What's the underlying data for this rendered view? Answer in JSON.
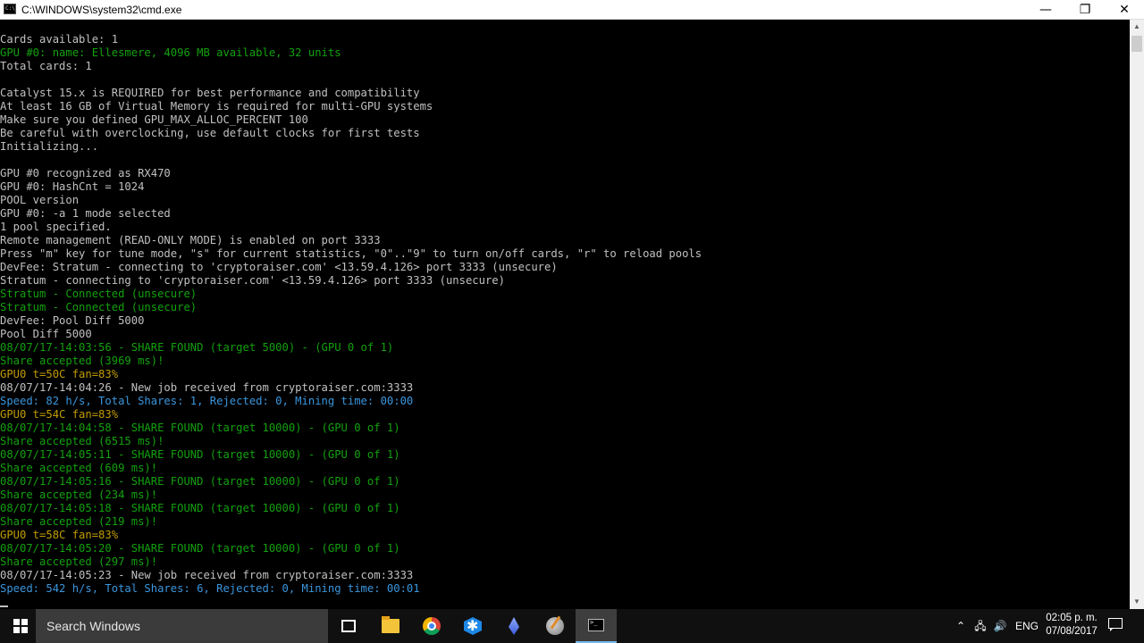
{
  "window": {
    "title": "C:\\WINDOWS\\system32\\cmd.exe",
    "minimize_glyph": "—",
    "maximize_glyph": "❐",
    "close_glyph": "✕"
  },
  "console": {
    "colors": {
      "white": "#c0c0c0",
      "green": "#13a10e",
      "yellow": "#c19c00",
      "cyan": "#3a96dd"
    },
    "lines": [
      {
        "text": "Cards available: 1",
        "color": "white"
      },
      {
        "text": "GPU #0: name: Ellesmere, 4096 MB available, 32 units",
        "color": "green"
      },
      {
        "text": "Total cards: 1",
        "color": "white"
      },
      {
        "text": "",
        "color": "white"
      },
      {
        "text": "Catalyst 15.x is REQUIRED for best performance and compatibility",
        "color": "white"
      },
      {
        "text": "At least 16 GB of Virtual Memory is required for multi-GPU systems",
        "color": "white"
      },
      {
        "text": "Make sure you defined GPU_MAX_ALLOC_PERCENT 100",
        "color": "white"
      },
      {
        "text": "Be careful with overclocking, use default clocks for first tests",
        "color": "white"
      },
      {
        "text": "Initializing...",
        "color": "white"
      },
      {
        "text": "",
        "color": "white"
      },
      {
        "text": "GPU #0 recognized as RX470",
        "color": "white"
      },
      {
        "text": "GPU #0: HashCnt = 1024",
        "color": "white"
      },
      {
        "text": "POOL version",
        "color": "white"
      },
      {
        "text": "GPU #0: -a 1 mode selected",
        "color": "white"
      },
      {
        "text": "1 pool specified.",
        "color": "white"
      },
      {
        "text": "Remote management (READ-ONLY MODE) is enabled on port 3333",
        "color": "white"
      },
      {
        "text": "Press \"m\" key for tune mode, \"s\" for current statistics, \"0\"..\"9\" to turn on/off cards, \"r\" to reload pools",
        "color": "white"
      },
      {
        "text": "DevFee: Stratum - connecting to 'cryptoraiser.com' <13.59.4.126> port 3333 (unsecure)",
        "color": "white"
      },
      {
        "text": "Stratum - connecting to 'cryptoraiser.com' <13.59.4.126> port 3333 (unsecure)",
        "color": "white"
      },
      {
        "text": "Stratum - Connected (unsecure)",
        "color": "green"
      },
      {
        "text": "Stratum - Connected (unsecure)",
        "color": "green"
      },
      {
        "text": "DevFee: Pool Diff 5000",
        "color": "white"
      },
      {
        "text": "Pool Diff 5000",
        "color": "white"
      },
      {
        "text": "08/07/17-14:03:56 - SHARE FOUND (target 5000) - (GPU 0 of 1)",
        "color": "green"
      },
      {
        "text": "Share accepted (3969 ms)!",
        "color": "green"
      },
      {
        "text": "GPU0 t=50C fan=83%",
        "color": "yellow"
      },
      {
        "text": "08/07/17-14:04:26 - New job received from cryptoraiser.com:3333",
        "color": "white"
      },
      {
        "text": "Speed: 82 h/s, Total Shares: 1, Rejected: 0, Mining time: 00:00",
        "color": "cyan"
      },
      {
        "text": "GPU0 t=54C fan=83%",
        "color": "yellow"
      },
      {
        "text": "08/07/17-14:04:58 - SHARE FOUND (target 10000) - (GPU 0 of 1)",
        "color": "green"
      },
      {
        "text": "Share accepted (6515 ms)!",
        "color": "green"
      },
      {
        "text": "08/07/17-14:05:11 - SHARE FOUND (target 10000) - (GPU 0 of 1)",
        "color": "green"
      },
      {
        "text": "Share accepted (609 ms)!",
        "color": "green"
      },
      {
        "text": "08/07/17-14:05:16 - SHARE FOUND (target 10000) - (GPU 0 of 1)",
        "color": "green"
      },
      {
        "text": "Share accepted (234 ms)!",
        "color": "green"
      },
      {
        "text": "08/07/17-14:05:18 - SHARE FOUND (target 10000) - (GPU 0 of 1)",
        "color": "green"
      },
      {
        "text": "Share accepted (219 ms)!",
        "color": "green"
      },
      {
        "text": "GPU0 t=58C fan=83%",
        "color": "yellow"
      },
      {
        "text": "08/07/17-14:05:20 - SHARE FOUND (target 10000) - (GPU 0 of 1)",
        "color": "green"
      },
      {
        "text": "Share accepted (297 ms)!",
        "color": "green"
      },
      {
        "text": "08/07/17-14:05:23 - New job received from cryptoraiser.com:3333",
        "color": "white"
      },
      {
        "text": "Speed: 542 h/s, Total Shares: 6, Rejected: 0, Mining time: 00:01",
        "color": "cyan"
      }
    ]
  },
  "scrollbar": {
    "up_glyph": "▲",
    "down_glyph": "▼"
  },
  "taskbar": {
    "search_placeholder": "Search Windows",
    "apps": [
      "task-view-icon",
      "file-explorer-icon",
      "chrome-icon",
      "snowflake-app-icon",
      "ethereum-icon",
      "utility-app-icon",
      "command-prompt-icon"
    ],
    "tray": {
      "chevron_glyph": "⌃",
      "network_glyph": "🖧",
      "volume_glyph": "🔊",
      "language": "ENG",
      "time": "02:05 p. m.",
      "date": "07/08/2017"
    }
  }
}
